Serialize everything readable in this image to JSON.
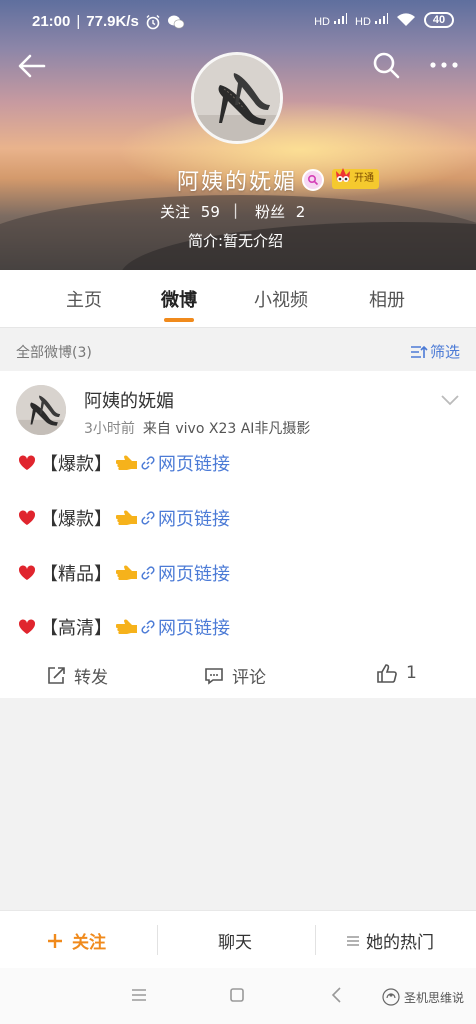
{
  "statusbar": {
    "time": "21:00",
    "sep": "|",
    "speed": "77.9K/s",
    "signal1": "HD",
    "signal2": "HD",
    "battery": "40"
  },
  "profile": {
    "name": "阿姨的妩媚",
    "vip_label": "开通",
    "follow_label": "关注",
    "follow_count": "59",
    "stat_separator": "|",
    "fans_label": "粉丝",
    "fans_count": "2",
    "bio": "简介:暂无介绍"
  },
  "tabs": [
    {
      "label": "主页"
    },
    {
      "label": "微博"
    },
    {
      "label": "小视频"
    },
    {
      "label": "相册"
    }
  ],
  "filter": {
    "title": "全部微博(3)",
    "button": "筛选"
  },
  "post": {
    "author": "阿姨的妩媚",
    "time": "3小时前",
    "source": "来自 vivo X23 AI非凡摄影",
    "lines": [
      {
        "tag": "【爆款】",
        "link": "网页链接"
      },
      {
        "tag": "【爆款】",
        "link": "网页链接"
      },
      {
        "tag": "【精品】",
        "link": "网页链接"
      },
      {
        "tag": "【高清】",
        "link": "网页链接"
      }
    ],
    "actions": {
      "repost": "转发",
      "comment": "评论",
      "like_count": "1"
    }
  },
  "bottombar": {
    "follow": "关注",
    "chat": "聊天",
    "hot": "她的热门"
  },
  "watermark": "圣机思维说",
  "colors": {
    "accent": "#f08a1c",
    "link": "#4c7bd6"
  }
}
